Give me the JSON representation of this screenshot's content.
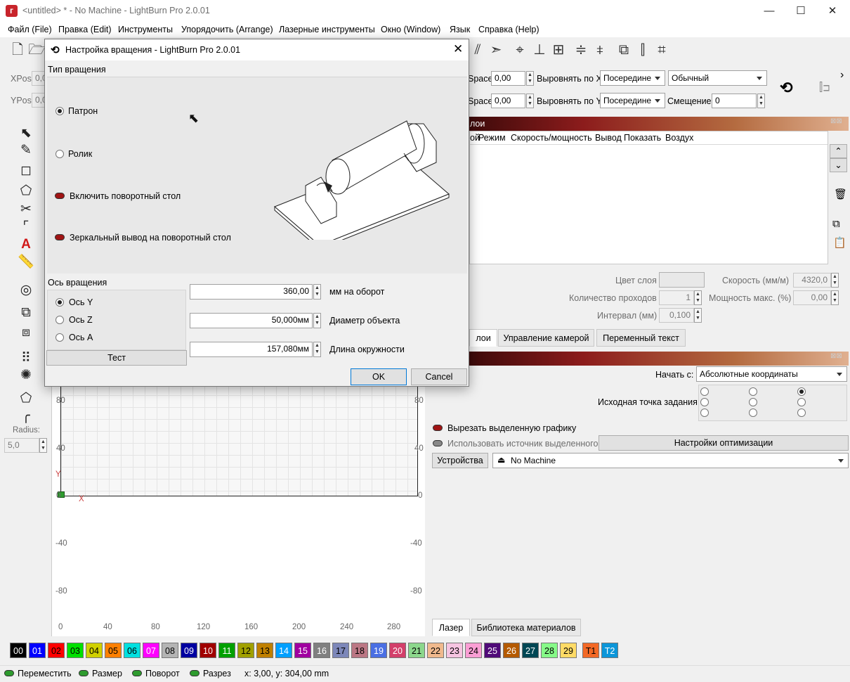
{
  "window": {
    "title": "<untitled> * - No Machine - LightBurn Pro 2.0.01",
    "controls": [
      "—",
      "☐",
      "✕"
    ]
  },
  "menu": [
    "Файл (File)",
    "Правка (Edit)",
    "Инструменты",
    "Упорядочить (Arrange)",
    "Лазерные инструменты",
    "Окно (Window)",
    "Язык",
    "Справка (Help)"
  ],
  "toolbar_icons": [
    "new-file-icon",
    "open-folder-icon",
    "mirror-icon",
    "send-icon",
    "target-icon",
    "align-icon",
    "distribute-icon"
  ],
  "numeric_edits": {
    "xpos_label": "XPos",
    "xpos_value": "0,0",
    "ypos_label": "YPos",
    "ypos_value": "0,0",
    "space_label_1": "Space",
    "space_value_1": "0,00",
    "space_label_2": "Space",
    "space_value_2": "0,00",
    "align_x_label": "Выровнять по X",
    "align_x_value": "Посередине",
    "align_y_label": "Выровнять по Y",
    "align_y_value": "Посередине",
    "font_mode_value": "Обычный",
    "offset_label": "Смещение",
    "offset_value": "0"
  },
  "layers_panel": {
    "header": "лои",
    "columns": [
      "ой",
      "Режим",
      "Скорость/мощность",
      "Вывод",
      "Показать",
      "Воздух"
    ],
    "layer_color_label": "Цвет слоя",
    "speed_label": "Скорость (мм/м)",
    "speed_value": "4320,0",
    "passes_label": "Количество проходов",
    "passes_value": "1",
    "max_power_label": "Мощность макс. (%)",
    "max_power_value": "0,00",
    "interval_label": "Интервал (мм)",
    "interval_value": "0,100",
    "tabs": [
      "лои",
      "Управление камерой",
      "Переменный текст"
    ]
  },
  "laser_panel": {
    "start_from_label": "Начать с:",
    "start_from_value": "Абсолютные координаты",
    "job_origin_label": "Исходная точка задания",
    "cut_selected_label": "Вырезать выделенную графику",
    "use_selection_origin_label": "Использовать источник выделенного",
    "optimization_button": "Настройки оптимизации",
    "devices_button": "Устройства",
    "device_value": "No Machine",
    "tabs": [
      "Лазер",
      "Библиотека материалов"
    ]
  },
  "left_panel": {
    "radius_label": "Radius:",
    "radius_value": "5,0"
  },
  "canvas": {
    "left_y_ticks": [
      "80",
      "40",
      "0",
      "-40",
      "-80"
    ],
    "right_y_ticks": [
      "80",
      "40",
      "0",
      "-40",
      "-80"
    ],
    "x_ticks": [
      "0",
      "40",
      "80",
      "120",
      "160",
      "200",
      "240",
      "280"
    ],
    "y_axis_label": "Y",
    "x_axis_label": "X"
  },
  "palette": [
    {
      "label": "00",
      "bg": "#000000",
      "fg": "#ffffff"
    },
    {
      "label": "01",
      "bg": "#0000ff",
      "fg": "#ffffff"
    },
    {
      "label": "02",
      "bg": "#ff0000",
      "fg": "#000000"
    },
    {
      "label": "03",
      "bg": "#00e000",
      "fg": "#000000"
    },
    {
      "label": "04",
      "bg": "#d0d000",
      "fg": "#000000"
    },
    {
      "label": "05",
      "bg": "#ff8000",
      "fg": "#000000"
    },
    {
      "label": "06",
      "bg": "#00e0e0",
      "fg": "#000000"
    },
    {
      "label": "07",
      "bg": "#ff00ff",
      "fg": "#ffffff"
    },
    {
      "label": "08",
      "bg": "#b4b4b4",
      "fg": "#000000"
    },
    {
      "label": "09",
      "bg": "#0000a0",
      "fg": "#ffffff"
    },
    {
      "label": "10",
      "bg": "#a00000",
      "fg": "#ffffff"
    },
    {
      "label": "11",
      "bg": "#00a000",
      "fg": "#ffffff"
    },
    {
      "label": "12",
      "bg": "#a0a000",
      "fg": "#000000"
    },
    {
      "label": "13",
      "bg": "#c08000",
      "fg": "#000000"
    },
    {
      "label": "14",
      "bg": "#00a0ff",
      "fg": "#ffffff"
    },
    {
      "label": "15",
      "bg": "#a000a0",
      "fg": "#ffffff"
    },
    {
      "label": "16",
      "bg": "#808080",
      "fg": "#ffffff"
    },
    {
      "label": "17",
      "bg": "#7d87b9",
      "fg": "#000000"
    },
    {
      "label": "18",
      "bg": "#bb7784",
      "fg": "#000000"
    },
    {
      "label": "19",
      "bg": "#4a6fe3",
      "fg": "#ffffff"
    },
    {
      "label": "20",
      "bg": "#d33f6a",
      "fg": "#ffffff"
    },
    {
      "label": "21",
      "bg": "#8cd78c",
      "fg": "#000000"
    },
    {
      "label": "22",
      "bg": "#f0b98d",
      "fg": "#000000"
    },
    {
      "label": "23",
      "bg": "#f6c4e1",
      "fg": "#000000"
    },
    {
      "label": "24",
      "bg": "#fa9ed4",
      "fg": "#000000"
    },
    {
      "label": "25",
      "bg": "#500a78",
      "fg": "#ffffff"
    },
    {
      "label": "26",
      "bg": "#b45a00",
      "fg": "#ffffff"
    },
    {
      "label": "27",
      "bg": "#004754",
      "fg": "#ffffff"
    },
    {
      "label": "28",
      "bg": "#86fa88",
      "fg": "#000000"
    },
    {
      "label": "29",
      "bg": "#ffdb66",
      "fg": "#000000"
    },
    {
      "label": "T1",
      "bg": "#f36926",
      "fg": "#000000"
    },
    {
      "label": "T2",
      "bg": "#0c96d9",
      "fg": "#ffffff"
    }
  ],
  "status_bar": {
    "move": "Переместить",
    "size": "Размер",
    "rotate": "Поворот",
    "cut": "Разрез",
    "coords": "x: 3,00, y: 304,00 mm"
  },
  "dialog": {
    "title": "Настройка вращения - LightBurn Pro 2.0.01",
    "rotary_type_label": "Тип вращения",
    "chuck_label": "Патрон",
    "roller_label": "Ролик",
    "enable_rotary_label": "Включить поворотный стол",
    "mirror_output_label": "Зеркальный вывод на поворотный стол",
    "rotary_axis_label": "Ось вращения",
    "axis_y_label": "Ось Y",
    "axis_z_label": "Ось Z",
    "axis_a_label": "Ось A",
    "test_button": "Тест",
    "mm_per_rotation_value": "360,00",
    "mm_per_rotation_label": "мм на оборот",
    "object_diameter_value": "50,000мм",
    "object_diameter_label": "Диаметр объекта",
    "circumference_value": "157,080мм",
    "circumference_label": "Длина окружности",
    "ok_button": "OK",
    "cancel_button": "Cancel",
    "selected_type": "Патрон",
    "selected_axis": "Ось Y"
  }
}
